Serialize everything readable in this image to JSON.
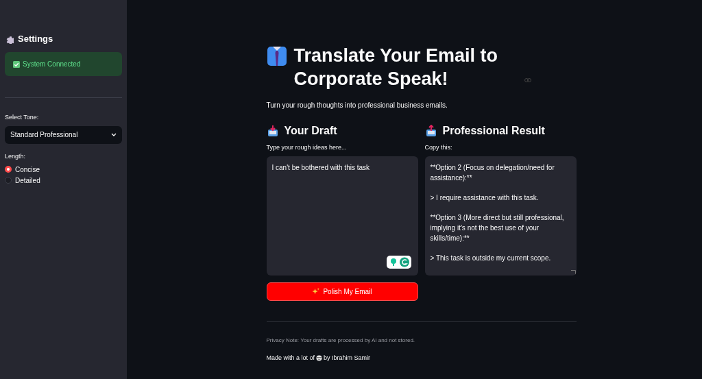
{
  "sidebar": {
    "title": "Settings",
    "status": "System Connected",
    "tone": {
      "label": "Select Tone:",
      "value": "Standard Professional"
    },
    "length": {
      "label": "Length:",
      "options": [
        {
          "label": "Concise",
          "selected": true
        },
        {
          "label": "Detailed",
          "selected": false
        }
      ]
    }
  },
  "main": {
    "title": "Translate Your Email to Corporate Speak!",
    "subtitle": "Turn your rough thoughts into professional business emails.",
    "draft": {
      "heading": "Your Draft",
      "label": "Type your rough ideas here...",
      "value": "I can't be bothered with this task"
    },
    "result": {
      "heading": "Professional Result",
      "label": "Copy this:",
      "paragraphs": [
        "**Option 2 (Focus on delegation/need for assistance):**",
        "> I require assistance with this task.",
        "**Option 3 (More direct but still professional, implying it's not the best use of your skills/time):**",
        "> This task is outside my current scope."
      ]
    },
    "button": "Polish My Email",
    "privacy": "Privacy Note: Your drafts are processed by AI and not stored.",
    "credit_before": "Made with a lot of",
    "credit_after": "by Ibrahim Samir"
  }
}
